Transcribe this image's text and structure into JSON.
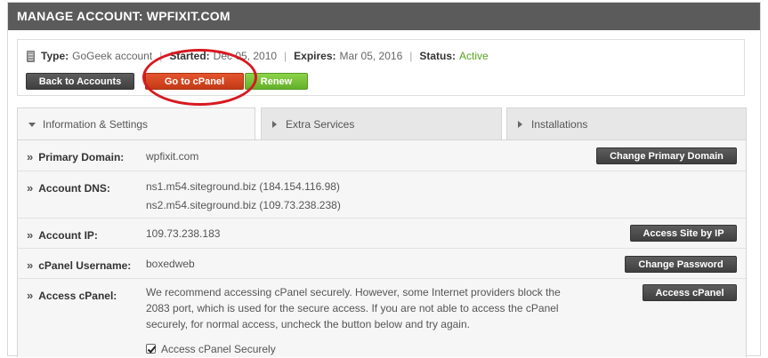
{
  "header": {
    "title": "MANAGE ACCOUNT: WPFIXIT.COM"
  },
  "account": {
    "type_label": "Type:",
    "type_value": "GoGeek account",
    "started_label": "Started:",
    "started_value": "Dec 05, 2010",
    "expires_label": "Expires:",
    "expires_value": "Mar 05, 2016",
    "status_label": "Status:",
    "status_value": "Active",
    "status_color": "#5aa321",
    "separator": "|"
  },
  "actions": {
    "back_label": "Back to Accounts",
    "cpanel_label": "Go to cPanel",
    "renew_label": "Renew"
  },
  "tabs": [
    {
      "label": "Information & Settings",
      "active": true
    },
    {
      "label": "Extra Services",
      "active": false
    },
    {
      "label": "Installations",
      "active": false
    }
  ],
  "rows": {
    "primary_domain": {
      "label": "Primary Domain:",
      "value": "wpfixit.com",
      "button": "Change Primary Domain"
    },
    "account_dns": {
      "label": "Account DNS:",
      "ns1": "ns1.m54.siteground.biz (184.154.116.98)",
      "ns2": "ns2.m54.siteground.biz (109.73.238.238)"
    },
    "account_ip": {
      "label": "Account IP:",
      "value": "109.73.238.183",
      "button": "Access Site by IP"
    },
    "cpanel_username": {
      "label": "cPanel Username:",
      "value": "boxedweb",
      "button": "Change Password"
    },
    "access_cpanel": {
      "label": "Access cPanel:",
      "line1": "We recommend accessing cPanel securely. However, some Internet providers block the",
      "line2": "2083 port, which is used for the secure access. If you are not able to access the cPanel",
      "line3": "securely, for normal access, uncheck the button below and try again.",
      "checkbox_label": "Access cPanel Securely",
      "checkbox_checked": true,
      "button": "Access cPanel"
    }
  },
  "chevron": "»",
  "icons": {
    "server": "server-icon",
    "tab_active": "arrow-down-icon",
    "tab_inactive": "arrow-right-icon"
  },
  "colors": {
    "header_bg": "#5b5b5b",
    "cpanel_button": "#d94a23",
    "renew_button": "#78c23a",
    "highlight_circle": "#d71920"
  }
}
